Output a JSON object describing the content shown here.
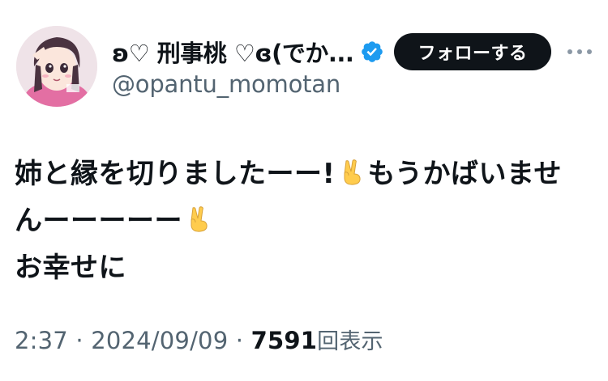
{
  "author": {
    "display_name": "ʚ♡ 刑事桃 ♡ɞ(でか...",
    "handle": "@opantu_momotan",
    "verified": true,
    "avatar_icon": "avatar-anime-girl"
  },
  "actions": {
    "follow_label": "フォローする",
    "more_icon": "more-horizontal-icon"
  },
  "tweet": {
    "line1": "姉と縁を切りましたーー!",
    "line1b": "もうかばいませ",
    "line2": "んーーーーー",
    "line3": "お幸せに",
    "emoji": "victory-hand"
  },
  "meta": {
    "time": "2:37",
    "separator1": " · ",
    "date": "2024/09/09",
    "separator2": " · ",
    "views": "7591",
    "views_label": "回表示"
  },
  "colors": {
    "text_primary": "#0f1419",
    "text_secondary": "#536471",
    "verified_blue": "#1d9bf0",
    "button_bg": "#0f1419"
  }
}
